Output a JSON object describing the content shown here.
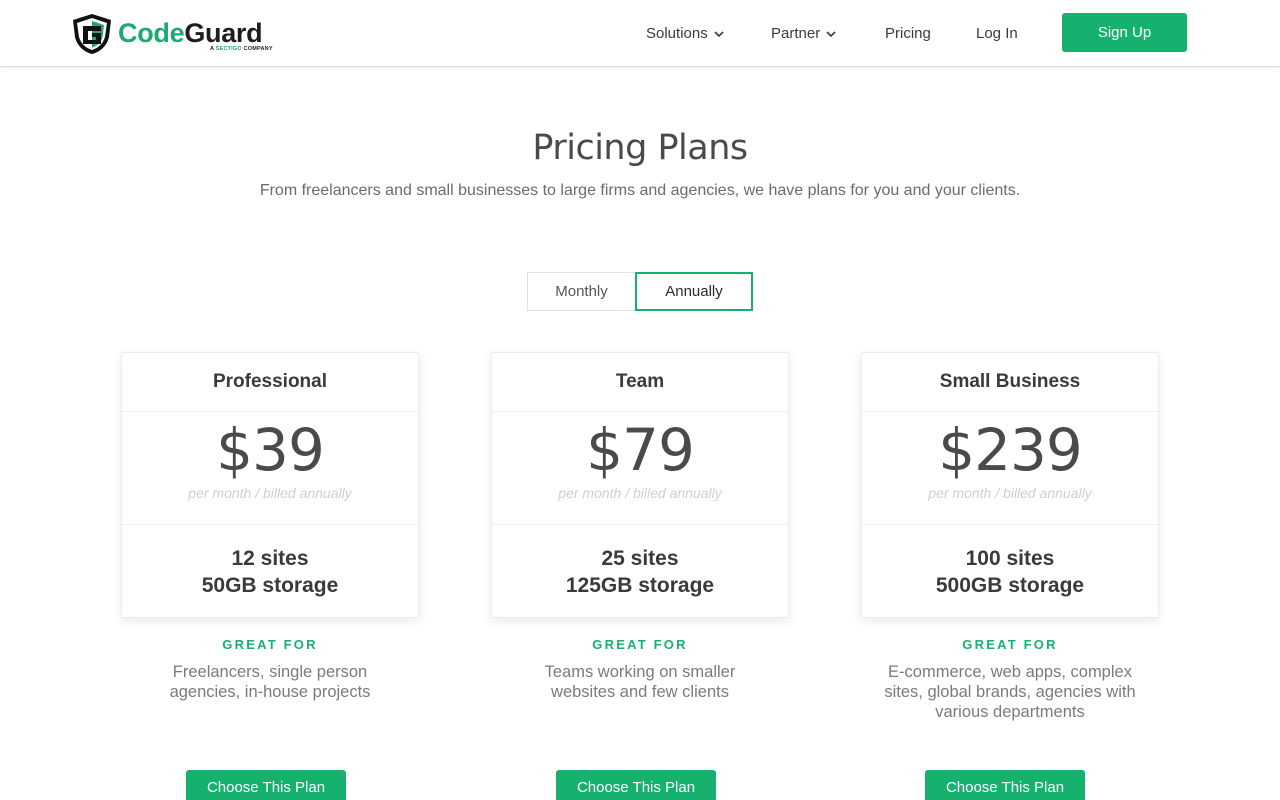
{
  "brand": {
    "name_part1": "Code",
    "name_part2": "Guard",
    "tagline_prefix": "A ",
    "tagline_brand": "SECTIGO",
    "tagline_suffix": " COMPANY",
    "accent_color": "#17b16f"
  },
  "nav": {
    "solutions": "Solutions",
    "partner": "Partner",
    "pricing": "Pricing",
    "login": "Log In",
    "signup": "Sign Up"
  },
  "hero": {
    "title": "Pricing Plans",
    "subtitle": "From freelancers and small businesses to large firms and agencies, we have plans for you and your clients."
  },
  "billing_toggle": {
    "options": [
      "Monthly",
      "Annually"
    ],
    "selected": "Annually"
  },
  "plans": [
    {
      "name": "Professional",
      "price": "$39",
      "billing": "per month / billed annually",
      "sites": "12 sites",
      "storage": "50GB storage",
      "great_for_label": "GREAT FOR",
      "great_for": "Freelancers, single person agencies, in-house projects",
      "cta": "Choose This Plan"
    },
    {
      "name": "Team",
      "price": "$79",
      "billing": "per month / billed annually",
      "sites": "25 sites",
      "storage": "125GB storage",
      "great_for_label": "GREAT FOR",
      "great_for": "Teams working on smaller websites and few clients",
      "cta": "Choose This Plan"
    },
    {
      "name": "Small Business",
      "price": "$239",
      "billing": "per month / billed annually",
      "sites": "100 sites",
      "storage": "500GB storage",
      "great_for_label": "GREAT FOR",
      "great_for": "E-commerce, web apps, complex sites, global brands, agencies with various departments",
      "cta": "Choose This Plan"
    }
  ]
}
